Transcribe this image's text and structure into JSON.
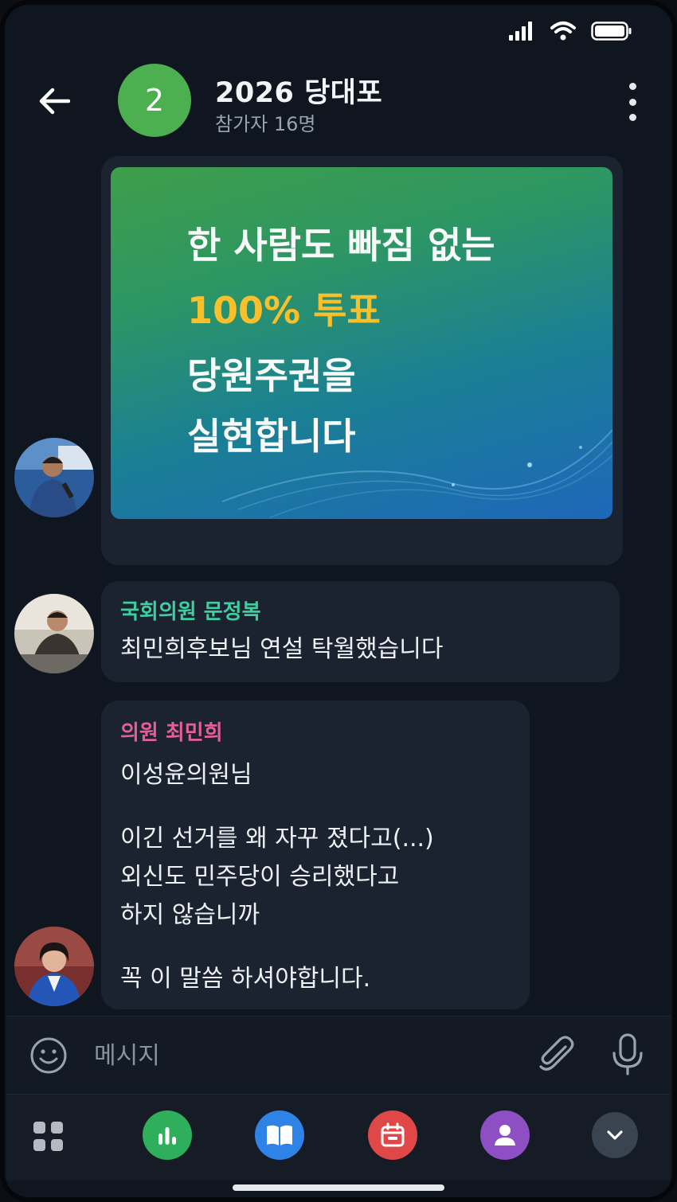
{
  "chat": {
    "title": "2026 당대포",
    "participants": "참가자 16명",
    "avatar_label": "2"
  },
  "banner": {
    "line1": "한 사람도 빠짐 없는",
    "line2": "100% 투표",
    "line3": "당원주권을",
    "line4": "실현합니다"
  },
  "messages": [
    {
      "sender": "국회의원 문정복",
      "sender_color": "#3ecfa0",
      "text": "최민희후보님 연설 탁월했습니다"
    },
    {
      "sender": "의원 최민희",
      "sender_color": "#e45f96",
      "paragraphs": [
        "이성윤의원님",
        "이긴 선거를 왜 자꾸 졌다고(...)\n외신도 민주당이 승리했다고\n하지 않습니까",
        "꼭 이 말씀 하셔야합니다."
      ]
    }
  ],
  "composer": {
    "placeholder": "메시지"
  },
  "colors": {
    "background": "#10161f",
    "bubble": "#1c2330",
    "group_avatar": "#4caf50",
    "banner_accent": "#f9c02c",
    "nav_stats": "#2fae5b",
    "nav_book": "#2f83e6",
    "nav_calendar": "#e04848",
    "nav_profile": "#8e4fc4",
    "nav_more": "#3a4350"
  },
  "icons": {
    "status": [
      "signal-icon",
      "wifi-icon",
      "battery-icon"
    ],
    "header": [
      "back-arrow-icon",
      "more-vert-icon"
    ],
    "composer": [
      "emoji-icon",
      "attach-icon",
      "mic-icon"
    ],
    "nav": [
      "apps-grid-icon",
      "stats-icon",
      "book-icon",
      "calendar-icon",
      "profile-icon",
      "chevron-down-icon"
    ]
  }
}
